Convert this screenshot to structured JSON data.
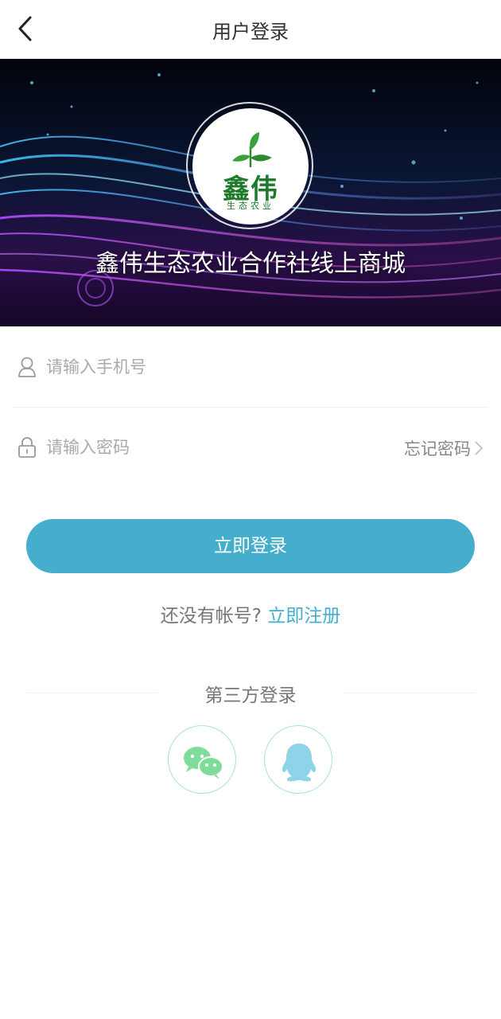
{
  "header": {
    "title": "用户登录",
    "back_icon": "chevron-left-icon"
  },
  "banner": {
    "logo_main": "鑫伟",
    "logo_sub": "生态农业",
    "shop_name": "鑫伟生态农业合作社线上商城"
  },
  "form": {
    "phone_placeholder": "请输入手机号",
    "password_placeholder": "请输入密码",
    "forgot_label": "忘记密码",
    "phone_icon": "user-icon",
    "password_icon": "lock-icon"
  },
  "actions": {
    "login_label": "立即登录",
    "no_account_text": "还没有帐号?",
    "register_label": "立即注册"
  },
  "third_party": {
    "title": "第三方登录",
    "providers": [
      "wechat-icon",
      "qq-icon"
    ]
  },
  "colors": {
    "accent": "#45aecd",
    "logo_green": "#1e7a2a",
    "wechat_green": "#7fdc9a",
    "qq_blue": "#8fd3ea"
  }
}
